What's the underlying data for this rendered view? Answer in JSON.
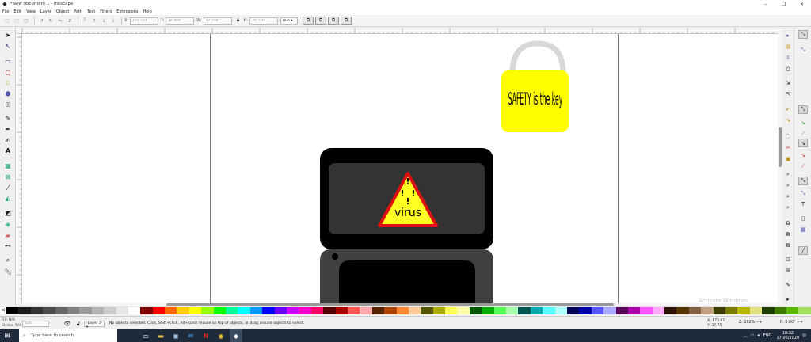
{
  "window": {
    "title": "*New document 1 - Inkscape",
    "minimize": "–",
    "maximize": "❐",
    "close": "✕"
  },
  "menu": [
    "File",
    "Edit",
    "View",
    "Layer",
    "Object",
    "Path",
    "Text",
    "Filters",
    "Extensions",
    "Help"
  ],
  "toolbar": {
    "x_label": "X:",
    "x_value": "153.514",
    "y_label": "Y:",
    "y_value": "36.404",
    "w_label": "W:",
    "w_value": "27.708",
    "h_label": "H:",
    "h_value": "20.716",
    "unit": "mm ▾"
  },
  "drawing": {
    "lock_text": "SAFETY is the key",
    "warning_marks": "!",
    "warning_text": "virus"
  },
  "status": {
    "fill_label": "Fill:",
    "fill_value": "N/A",
    "stroke_label": "Stroke:",
    "stroke_value": "N/A",
    "opacity_value": "100",
    "layer": "-Layer 1- ▾",
    "message": "No objects selected. Click, Shift+click, Alt+scroll mouse on top of objects, or drag around objects to select.",
    "x_label": "X:",
    "x_value": "173.91",
    "y_label": "Y:",
    "y_value": "37.75",
    "zoom_label": "Z:",
    "zoom_value": "162%",
    "rotate_label": "R:",
    "rotate_value": "0.00°"
  },
  "watermark": "Activate Windows",
  "taskbar": {
    "search_placeholder": "Type here to search",
    "lang": "ENG",
    "time": "18:32",
    "date": "17/06/2020"
  },
  "colors": {
    "lock_body": "#ffff00",
    "lock_shackle": "#d8d8d8",
    "laptop_frame": "#000000",
    "laptop_screen": "#333333",
    "warning_fill": "#ffff22",
    "warning_border": "#dd1111"
  },
  "palette": [
    "#000000",
    "#1a1a1a",
    "#333333",
    "#4d4d4d",
    "#666666",
    "#808080",
    "#999999",
    "#b3b3b3",
    "#cccccc",
    "#e6e6e6",
    "#ffffff",
    "#800000",
    "#ff0000",
    "#ff6600",
    "#ffcc00",
    "#ffff00",
    "#99ff00",
    "#00ff00",
    "#00ff99",
    "#00ffff",
    "#0099ff",
    "#0000ff",
    "#6600ff",
    "#cc00ff",
    "#ff00cc",
    "#ff0066",
    "#550000",
    "#aa0000",
    "#ff5555",
    "#ffaaaa",
    "#552200",
    "#aa4400",
    "#ff8833",
    "#ffcc99",
    "#555500",
    "#aaaa00",
    "#ffff55",
    "#ffffaa",
    "#005500",
    "#00aa00",
    "#55ff55",
    "#aaffaa",
    "#005555",
    "#00aaaa",
    "#55ffff",
    "#aaffff",
    "#000055",
    "#0000aa",
    "#5555ff",
    "#aaaaff",
    "#550055",
    "#aa00aa",
    "#ff55ff",
    "#ffaaff",
    "#2b1100",
    "#553300",
    "#806040",
    "#c0a080",
    "#3d3d00",
    "#7a7a00",
    "#b8b800",
    "#e0e080",
    "#1e3d00",
    "#3d7a00",
    "#5cb800",
    "#a3e060"
  ]
}
